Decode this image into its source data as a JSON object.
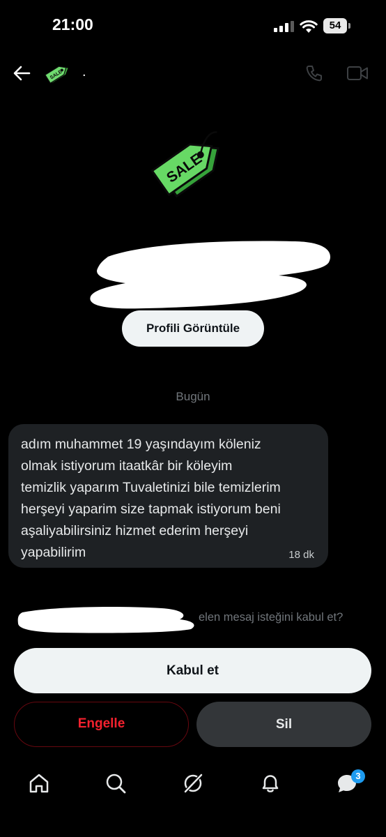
{
  "status_bar": {
    "time": "21:00",
    "battery": "54"
  },
  "header": {
    "name": "."
  },
  "avatar": {
    "tag_text": "SALE"
  },
  "profile_button": "Profili Görüntüle",
  "date_separator": "Bugün",
  "message": {
    "text": "adım muhammet 19 yaşındayım köleniz\nolmak istiyorum itaatkâr bir köleyim\ntemizlik yaparım Tuvaletinizi bile temizlerim\nherşeyi yaparim size tapmak istiyorum beni\naşaliyabilirsiniz hizmet ederim herşeyi\nyapabilirim",
    "time": "18 dk"
  },
  "request": {
    "question_visible": "elen mesaj isteğini kabul et?",
    "accept_label": "Kabul et",
    "block_label": "Engelle",
    "delete_label": "Sil"
  },
  "bottom_nav": {
    "messages_badge": "3"
  },
  "colors": {
    "background": "#000000",
    "bubble": "#1e2124",
    "danger": "#f4212e",
    "badge": "#1d9bf0",
    "tag_green": "#5fd35f"
  }
}
